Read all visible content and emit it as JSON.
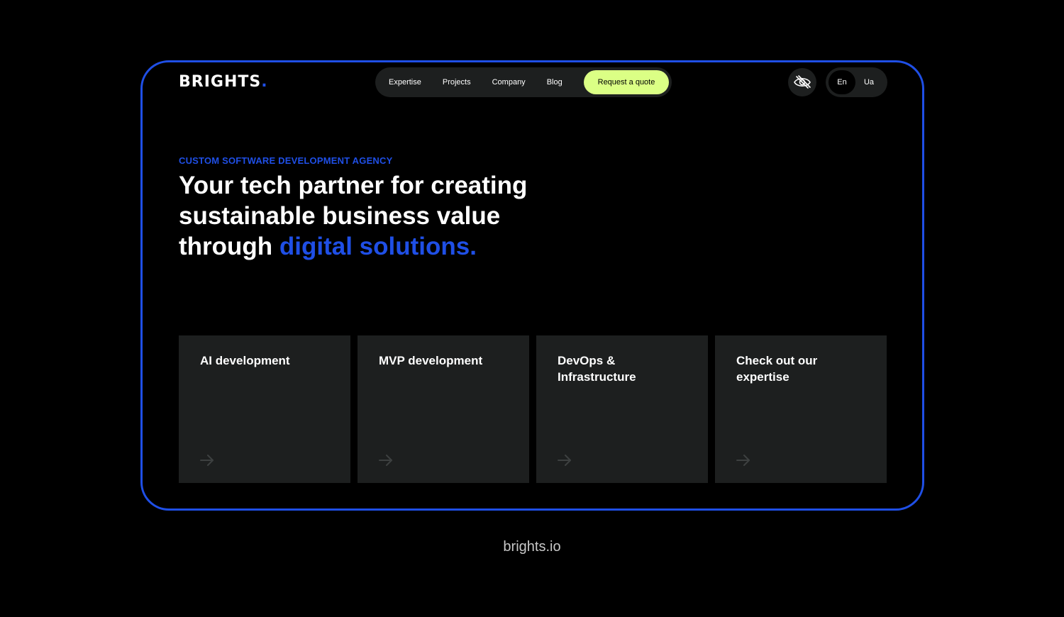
{
  "header": {
    "logo_text": "BRIGHTS",
    "logo_dot": ".",
    "nav_items": [
      {
        "label": "Expertise"
      },
      {
        "label": "Projects"
      },
      {
        "label": "Company"
      },
      {
        "label": "Blog"
      }
    ],
    "cta_label": "Request a quote",
    "accessibility_icon": "eye-off-icon",
    "languages": [
      {
        "label": "En",
        "active": true
      },
      {
        "label": "Ua",
        "active": false
      }
    ]
  },
  "hero": {
    "eyebrow": "CUSTOM SOFTWARE DEVELOPMENT AGENCY",
    "headline_part1": "Your tech partner for creating sustainable business value through ",
    "headline_accent": "digital solutions",
    "headline_dot": "."
  },
  "cards": [
    {
      "title": "AI development",
      "icon": "arrow-right-icon"
    },
    {
      "title": "MVP development",
      "icon": "arrow-right-icon"
    },
    {
      "title": "DevOps & Infrastructure",
      "icon": "arrow-right-icon"
    },
    {
      "title": "Check out our expertise",
      "icon": "arrow-right-icon"
    }
  ],
  "footer": {
    "url": "brights.io"
  },
  "colors": {
    "accent": "#1f4fe6",
    "cta": "#dbff85",
    "card": "#1d1f1f",
    "background": "#000000"
  }
}
